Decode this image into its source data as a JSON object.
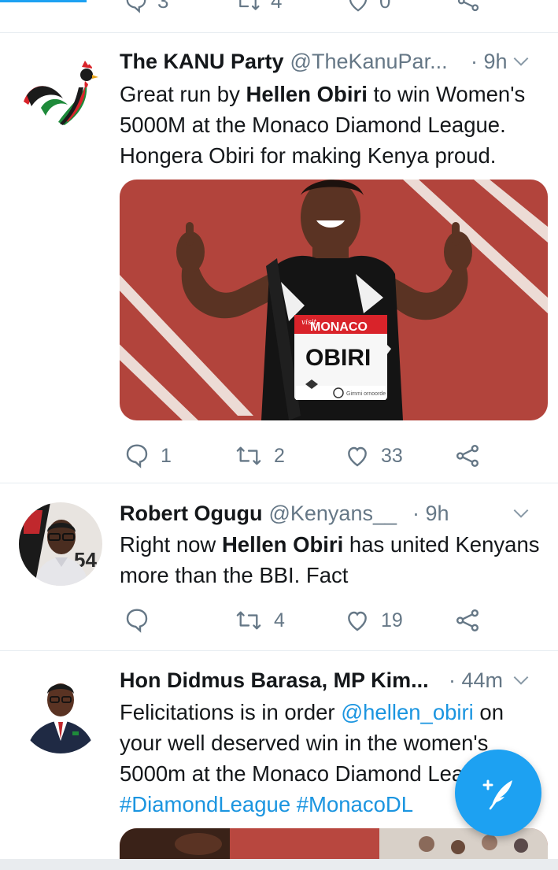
{
  "prev_tweet": {
    "reply_count": "3",
    "retweet_count": "4",
    "like_count": "0"
  },
  "tweets": [
    {
      "name": "The KANU Party",
      "handle": "@TheKanuPar...",
      "time": "· 9h",
      "text_parts": [
        "Great run by ",
        "Hellen Obiri",
        " to win Women's 5000M at the Monaco Diamond League. Hongera Obiri for making Kenya proud."
      ],
      "media": {
        "bib_brand": "MONACO",
        "bib_brand_small": "visit",
        "bib_name": "OBIRI",
        "bib_sponsor": "Gimmi ornoorde"
      },
      "reply_count": "1",
      "retweet_count": "2",
      "like_count": "33"
    },
    {
      "name": "Robert Ogugu",
      "handle": "@Kenyans__",
      "time": "· 9h",
      "text_parts": [
        "Right now ",
        "Hellen Obiri",
        " has united Kenyans more than the BBI. Fact"
      ],
      "avatar_text": "54",
      "reply_count": "",
      "retweet_count": "4",
      "like_count": "19"
    },
    {
      "name": "Hon Didmus Barasa, MP Kim...",
      "handle": "",
      "time": "· 44m",
      "text_parts": [
        "Felicitations is in order ",
        "@hellen_obiri",
        " on your well deserved win in the women's 5000m at the Monaco Diamond League",
        "#DiamondLeague #MonacoDL"
      ]
    }
  ],
  "colors": {
    "accent": "#1da1f2",
    "link": "#1b95e0",
    "muted": "#657786",
    "track_red": "#b8473f"
  }
}
